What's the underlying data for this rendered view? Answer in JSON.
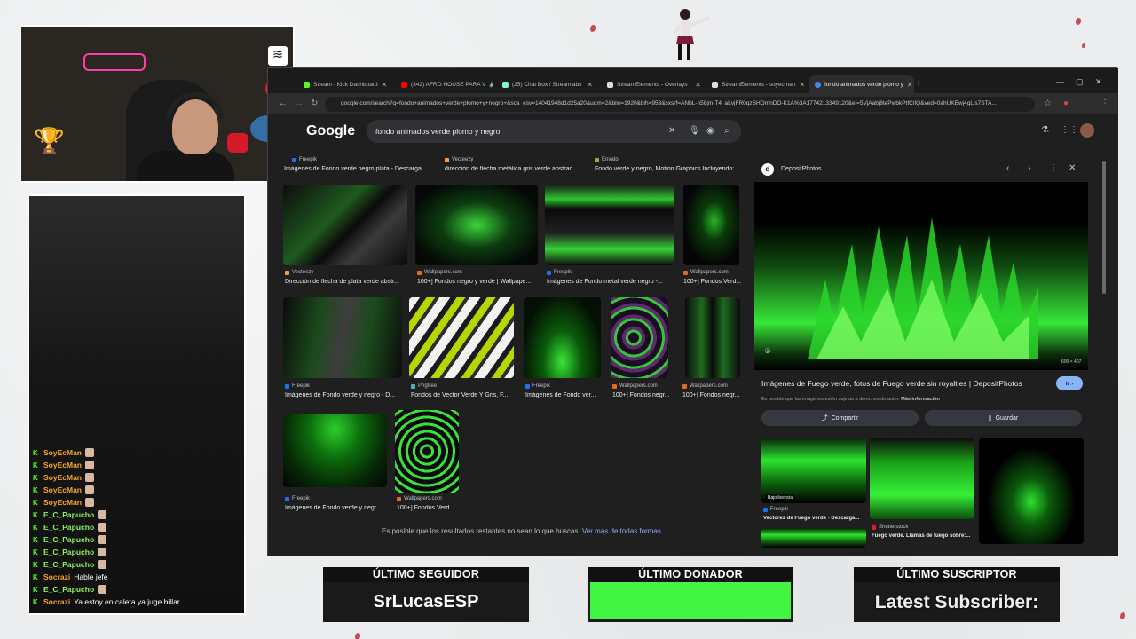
{
  "browser": {
    "tabs": [
      {
        "label": "Stream - Kick Dashboard",
        "color": "#53fc18"
      },
      {
        "label": "(342) AFRO HOUSE PARA V",
        "color": "#ff0000"
      },
      {
        "label": "(25) Chat Box / Streamlabs",
        "color": "#80f5d2"
      },
      {
        "label": "StreamElements - Overlays",
        "color": "#ffffff"
      },
      {
        "label": "StreamElements - soyecman",
        "color": "#ffffff"
      },
      {
        "label": "fondo animados verde plomo y",
        "color": "#4285f4"
      }
    ],
    "url": "google.com/search?q=fondo+animados+verde+plomo+y+negro+&sca_esv=14041948d1d25a20&udm=2&biw=1920&bih=953&sxsrf=ANbL-n58jm-T4_aLvjFR0qzSHOmnDO-K1A%3A1774213349120&ei=5VjAabj8tePwbkPtfCIlQ&ved=0ahUKEwj4gLjs7STA..."
  },
  "google": {
    "logo": "Google",
    "query": "fondo animados verde plomo y negro",
    "top_row": [
      {
        "source": "Freepik",
        "title": "Imágenes de Fondo verde negro plata - Descarga ..."
      },
      {
        "source": "Vecteezy",
        "title": "dirección de flecha metálica gris verde abstrac..."
      },
      {
        "source": "Envato",
        "title": "Fondo verde y negro, Motion Graphics Incluyendo:..."
      }
    ],
    "row1": [
      {
        "source": "Vecteezy",
        "title": "Dirección de flecha de plata verde abstr..."
      },
      {
        "source": "Wallpapers.com",
        "title": "100+] Fondos negro y verde | Wallpape..."
      },
      {
        "source": "Freepik",
        "title": "Imágenes de Fondo metal verde negro -..."
      },
      {
        "source": "Wallpapers.com",
        "title": "100+] Fondos Verd..."
      }
    ],
    "row2": [
      {
        "source": "Freepik",
        "title": "Imágenes de Fondo verde y negro - D..."
      },
      {
        "source": "Pngtree",
        "title": "Fondos de Vector Verde Y Gris, F..."
      },
      {
        "source": "Freepik",
        "title": "Imágenes de Fondo ver..."
      },
      {
        "source": "Wallpapers.com",
        "title": "100+] Fondos negr..."
      },
      {
        "source": "Wallpapers.com",
        "title": "100+] Fondos negr..."
      }
    ],
    "row3": [
      {
        "source": "Freepik",
        "title": "Imágenes de Fondo verde y negr..."
      },
      {
        "source": "Wallpapers.com",
        "title": "100+] Fondos Verd..."
      }
    ],
    "footer_text": "Es posible que los resultados restantes no sean lo que buscas.",
    "footer_link": "Ver más de todas formas"
  },
  "panel": {
    "source": "DepositPhotos",
    "size": "600 × 407",
    "title": "Imágenes de Fuego verde, fotos de Fuego verde sin royalties | DepositPhotos",
    "go_label": "Ir",
    "note": "Es posible que las imágenes estén sujetas a derechos de autor.",
    "note_link": "Más información",
    "share_label": "Compartir",
    "save_label": "Guardar",
    "related": [
      {
        "badge": "Bajo licencia",
        "source": "Freepik",
        "title": "Vectores de Fuego verde - Descarga..."
      },
      {
        "badge": "",
        "source": "Shutterstock",
        "title": "Fuego verde. Llamas de fuego sobre:..."
      },
      {
        "badge": "",
        "source": "",
        "title": ""
      }
    ]
  },
  "chat": [
    {
      "user": "SoyEcMan",
      "msg": ""
    },
    {
      "user": "SoyEcMan",
      "msg": ""
    },
    {
      "user": "SoyEcMan",
      "msg": ""
    },
    {
      "user": "SoyEcMan",
      "msg": ""
    },
    {
      "user": "SoyEcMan",
      "msg": ""
    },
    {
      "user": "E_C_Papucho",
      "msg": ""
    },
    {
      "user": "E_C_Papucho",
      "msg": ""
    },
    {
      "user": "E_C_Papucho",
      "msg": ""
    },
    {
      "user": "E_C_Papucho",
      "msg": ""
    },
    {
      "user": "E_C_Papucho",
      "msg": ""
    },
    {
      "user": "Socrazi",
      "msg": "Hable jefe"
    },
    {
      "user": "E_C_Papucho",
      "msg": ""
    },
    {
      "user": "Socrazi",
      "msg": "Ya estoy en caleta ya juge billar"
    }
  ],
  "widgets": {
    "follower": {
      "head": "ÚLTIMO SEGUIDOR",
      "value": "SrLucasESP"
    },
    "donor": {
      "head": "ÚLTIMO DONADOR",
      "value": ""
    },
    "subscriber": {
      "head": "ÚLTIMO SUSCRIPTOR",
      "value": "Latest Subscriber:"
    }
  },
  "colors": {
    "kick_green": "#53fc18",
    "donor_green": "#42f542"
  },
  "icons": [
    "wifi-icon",
    "no-phone-icon",
    "search-icon",
    "mic-icon",
    "lens-icon",
    "close-icon",
    "labs-icon",
    "apps-grid-icon",
    "star-icon",
    "back-icon",
    "forward-icon",
    "reload-icon",
    "more-icon",
    "share-icon",
    "bookmark-icon"
  ]
}
